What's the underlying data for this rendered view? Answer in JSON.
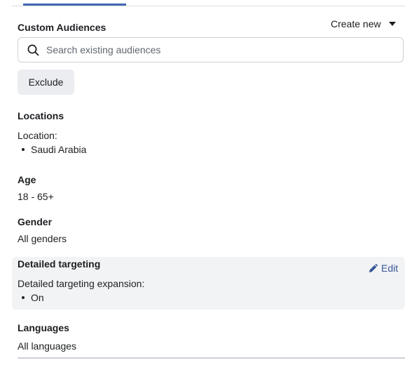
{
  "custom_audiences": {
    "title": "Custom Audiences",
    "create_new_label": "Create new",
    "search_placeholder": "Search existing audiences",
    "search_value": "",
    "exclude_label": "Exclude"
  },
  "locations": {
    "title": "Locations",
    "label": "Location:",
    "items": [
      "Saudi Arabia"
    ]
  },
  "age": {
    "title": "Age",
    "value": "18 - 65+"
  },
  "gender": {
    "title": "Gender",
    "value": "All genders"
  },
  "detailed_targeting": {
    "title": "Detailed targeting",
    "edit_label": "Edit",
    "expansion_label": "Detailed targeting expansion:",
    "items": [
      "On"
    ]
  },
  "languages": {
    "title": "Languages",
    "value": "All languages"
  },
  "icons": {
    "search": "search-icon",
    "create_new_caret": "caret-down-icon",
    "edit": "pencil-icon"
  },
  "colors": {
    "accent": "#4267b2",
    "link": "#385898",
    "panel_background": "#f2f3f5",
    "button_background": "#ebedf0"
  }
}
